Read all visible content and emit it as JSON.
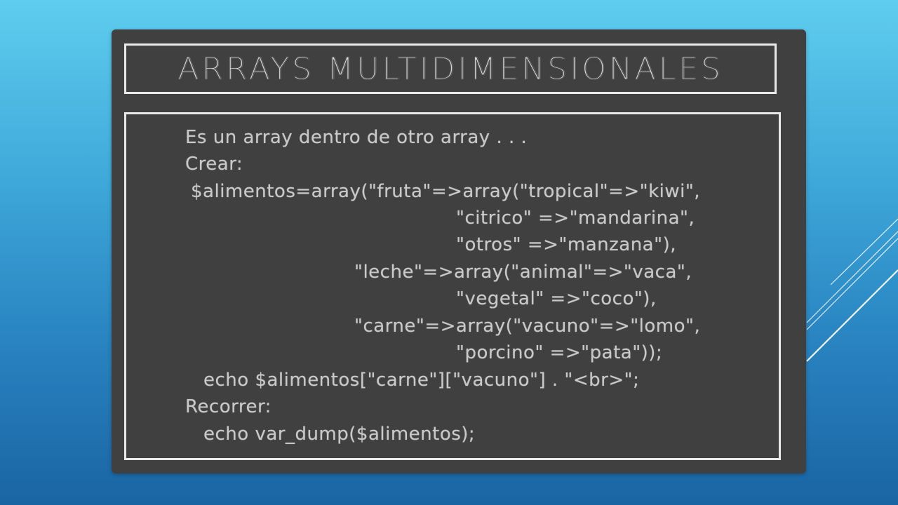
{
  "slide": {
    "title": "ARRAYS MULTIDIMENSIONALES",
    "lines": [
      "Es un array dentro de otro array . . .",
      "Crear:",
      "$alimentos=array(\"fruta\"=>array(\"tropical\"=>\"kiwi\",",
      "\"citrico\" =>\"mandarina\",",
      "\"otros\" =>\"manzana\"),",
      "\"leche\"=>array(\"animal\"=>\"vaca\",",
      "\"vegetal\" =>\"coco\"),",
      "\"carne\"=>array(\"vacuno\"=>\"lomo\",",
      "\"porcino\" =>\"pata\"));",
      "echo $alimentos[\"carne\"][\"vacuno\"] . \"<br>\";",
      "Recorrer:",
      "echo var_dump($alimentos);"
    ]
  },
  "colors": {
    "board": "#404040",
    "chalk": "#c9c9c9",
    "frame": "#e9e9e9",
    "background_top": "#5fcdee",
    "background_bottom": "#1a64a3"
  }
}
